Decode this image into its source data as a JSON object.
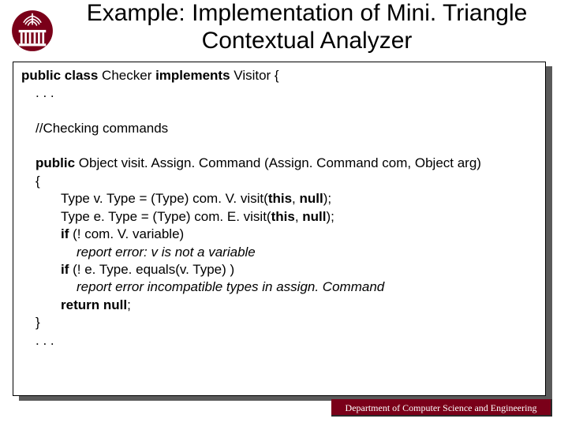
{
  "title": "Example: Implementation of Mini. Triangle Contextual Analyzer",
  "code": {
    "l1a": "public class",
    "l1b": " Checker ",
    "l1c": "implements",
    "l1d": " Visitor {",
    "l2": ". . .",
    "l3": "//Checking commands",
    "l4a": "public",
    "l4b": " Object visit. Assign. Command (Assign. Command com, Object arg)",
    "l5": "{",
    "l6a": "Type v. Type = (Type) com. V. visit(",
    "l6b": "this",
    "l6c": ", ",
    "l6d": "null",
    "l6e": ");",
    "l7a": "Type e. Type = (Type) com. E. visit(",
    "l7b": "this",
    "l7c": ", ",
    "l7d": "null",
    "l7e": ");",
    "l8a": "if",
    "l8b": " (! com. V. variable)",
    "l9": "report error: v is not a variable",
    "l10a": "if",
    "l10b": " (! e. Type. equals(v. Type) )",
    "l11": "report error incompatible types in assign. Command",
    "l12a": "return null",
    "l12b": ";",
    "l13": "}",
    "l14": ". . ."
  },
  "footer": "Department of Computer Science and Engineering"
}
